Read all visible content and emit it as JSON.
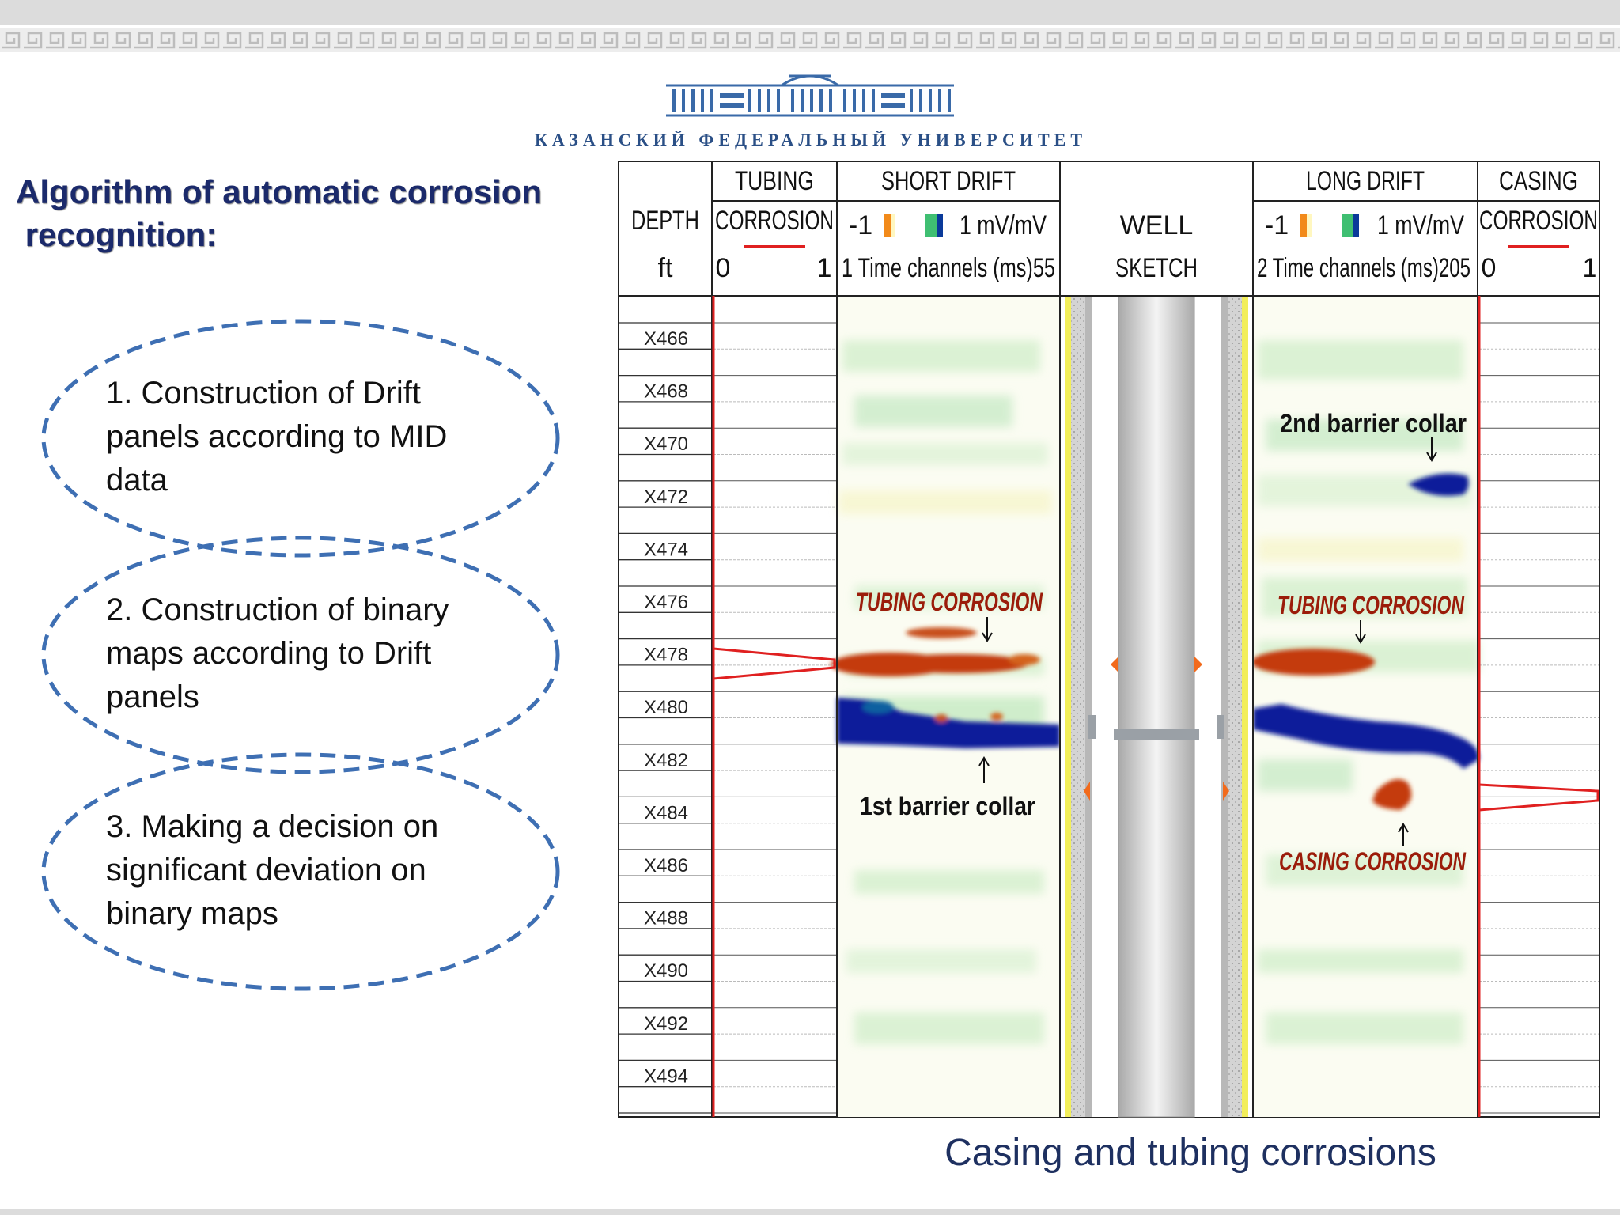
{
  "university": "КАЗАНСКИЙ ФЕДЕРАЛЬНЫЙ УНИВЕРСИТЕТ",
  "heading": {
    "line1": "Algorithm of automatic corrosion",
    "line2": " recognition:"
  },
  "steps": [
    {
      "lines": [
        "1.  Construction  of  Drift",
        "panels according to MID",
        "data"
      ]
    },
    {
      "lines": [
        "2. Construction of binary",
        "maps  according  to  Drift",
        "panels"
      ]
    },
    {
      "lines": [
        "3. Making a decision on",
        "significant  deviation  on",
        "binary maps"
      ]
    }
  ],
  "log": {
    "depth_header": {
      "line1": "DEPTH",
      "line2": "ft"
    },
    "tubing_corrosion_header": {
      "title": "TUBING",
      "name": "CORROSION",
      "min": "0",
      "max": "1"
    },
    "short_drift_header": {
      "title": "SHORT DRIFT",
      "scale_min": "-1",
      "scale_max": "1 mV/mV",
      "channels": "1 Time channels (ms)55"
    },
    "well_sketch_header": {
      "line1": "WELL",
      "line2": "SKETCH"
    },
    "long_drift_header": {
      "title": "LONG DRIFT",
      "scale_min": "-1",
      "scale_max": "1 mV/mV",
      "channels": "2 Time channels (ms)205"
    },
    "casing_corrosion_header": {
      "title": "CASING",
      "name": "CORROSION",
      "min": "0",
      "max": "1"
    },
    "depth_labels": [
      "X466",
      "X468",
      "X470",
      "X472",
      "X474",
      "X476",
      "X478",
      "X480",
      "X482",
      "X484",
      "X486",
      "X488",
      "X490",
      "X492",
      "X494"
    ],
    "annotations": {
      "short_tubing_corrosion": "TUBING CORROSION",
      "first_barrier_collar": "1st barrier collar",
      "second_barrier_collar": "2nd barrier collar",
      "long_tubing_corrosion": "TUBING CORROSION",
      "casing_corrosion": "CASING CORROSION"
    },
    "colors": {
      "corrosion_curve": "#e02020",
      "anomaly_positive": "#c43a0a",
      "anomaly_negative": "#0a1f9a",
      "background_green": "#d6f0cf",
      "tubing": "#c8c8c8",
      "cement": "#f5f064"
    }
  },
  "caption": "Casing and tubing corrosions"
}
